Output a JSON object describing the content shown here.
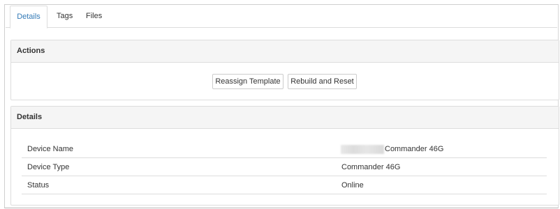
{
  "tabs": [
    {
      "label": "Details",
      "active": true
    },
    {
      "label": "Tags",
      "active": false
    },
    {
      "label": "Files",
      "active": false
    }
  ],
  "actions_panel": {
    "title": "Actions",
    "buttons": {
      "reassign_label": "Reassign Template",
      "rebuild_label": "Rebuild and Reset"
    }
  },
  "details_panel": {
    "title": "Details",
    "rows": [
      {
        "label": "Device Name",
        "value": "Commander 46G",
        "value_prefix_redacted": true
      },
      {
        "label": "Device Type",
        "value": "Commander 46G"
      },
      {
        "label": "Status",
        "value": "Online"
      }
    ]
  },
  "colors": {
    "active_tab": "#337ab7",
    "panel_heading_bg": "#f5f5f5",
    "border": "#dddddd"
  }
}
